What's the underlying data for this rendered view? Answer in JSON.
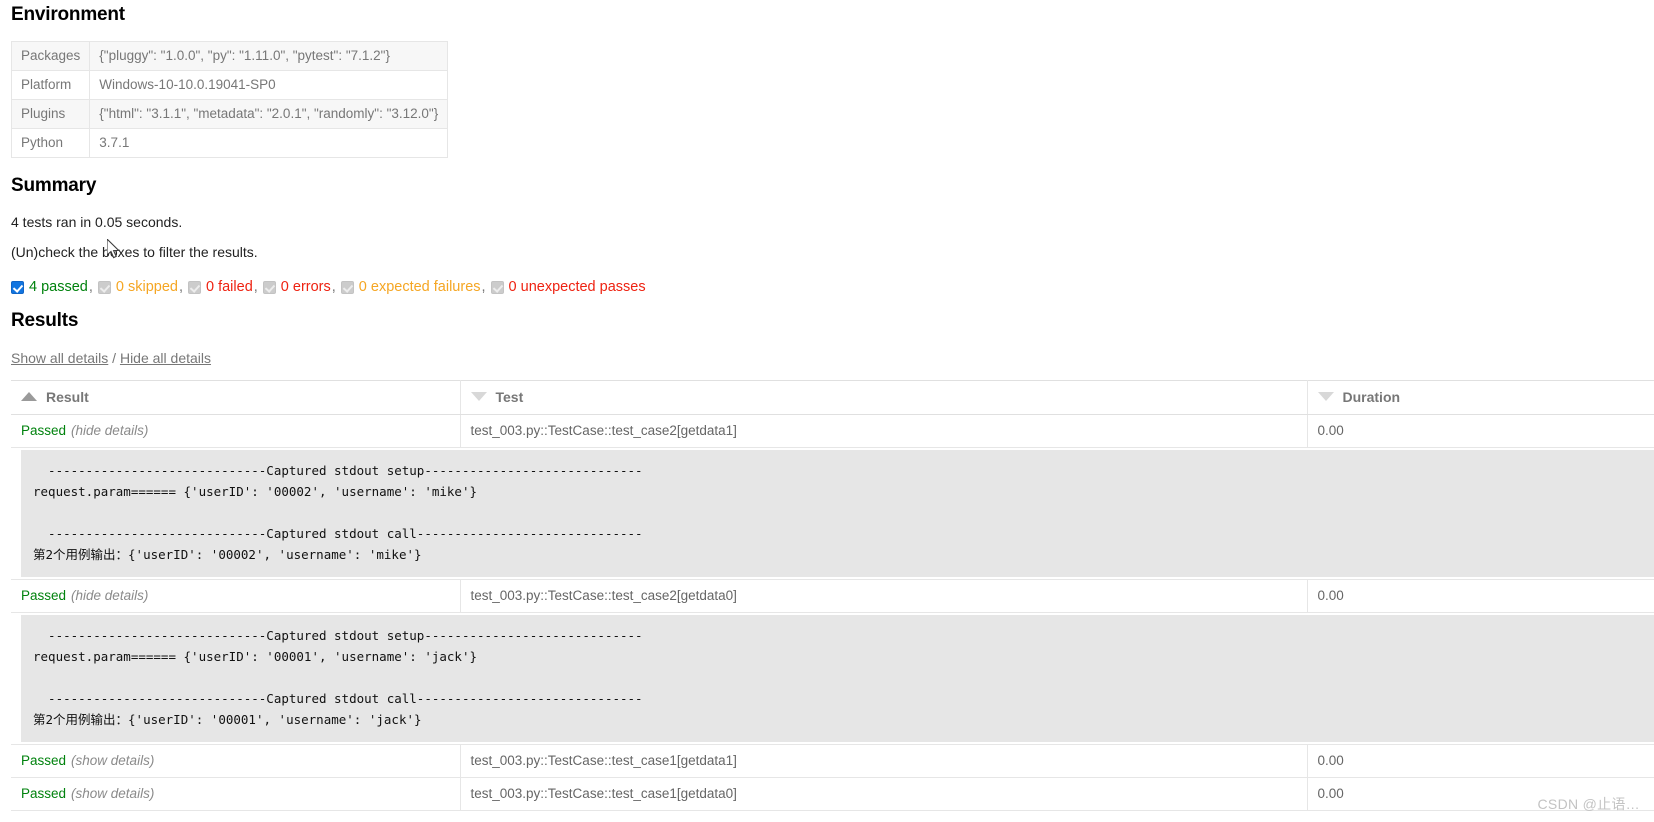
{
  "environment": {
    "title": "Environment",
    "rows": [
      {
        "key": "Packages",
        "value": "{\"pluggy\": \"1.0.0\", \"py\": \"1.11.0\", \"pytest\": \"7.1.2\"}"
      },
      {
        "key": "Platform",
        "value": "Windows-10-10.0.19041-SP0"
      },
      {
        "key": "Plugins",
        "value": "{\"html\": \"3.1.1\", \"metadata\": \"2.0.1\", \"randomly\": \"3.12.0\"}"
      },
      {
        "key": "Python",
        "value": "3.7.1"
      }
    ]
  },
  "summary": {
    "title": "Summary",
    "tests_ran": "4 tests ran in 0.05 seconds.",
    "filter_hint": "(Un)check the boxes to filter the results.",
    "filters": [
      {
        "label": "4 passed",
        "checked": true,
        "color": "#00820d",
        "trailing": ","
      },
      {
        "label": "0 skipped",
        "checked": false,
        "color": "#f5a623",
        "trailing": ","
      },
      {
        "label": "0 failed",
        "checked": false,
        "color": "#ee2211",
        "trailing": ","
      },
      {
        "label": "0 errors",
        "checked": false,
        "color": "#ee2211",
        "trailing": ","
      },
      {
        "label": "0 expected failures",
        "checked": false,
        "color": "#f5a623",
        "trailing": ","
      },
      {
        "label": "0 unexpected passes",
        "checked": false,
        "color": "#ee2211",
        "trailing": ""
      }
    ]
  },
  "results": {
    "title": "Results",
    "show_all_label": "Show all details",
    "separator": "/",
    "hide_all_label": "Hide all details",
    "columns": [
      {
        "label": "Result",
        "sort": "asc"
      },
      {
        "label": "Test",
        "sort": "desc"
      },
      {
        "label": "Duration",
        "sort": "desc"
      }
    ],
    "rows": [
      {
        "result": "Passed",
        "toggle": "(hide details)",
        "test": "test_003.py::TestCase::test_case2[getdata1]",
        "duration": "0.00",
        "log": "  -----------------------------Captured stdout setup-----------------------------\nrequest.param====== {'userID': '00002', 'username': 'mike'}\n\n  -----------------------------Captured stdout call------------------------------\n第2个用例输出：{'userID': '00002', 'username': 'mike'}"
      },
      {
        "result": "Passed",
        "toggle": "(hide details)",
        "test": "test_003.py::TestCase::test_case2[getdata0]",
        "duration": "0.00",
        "log": "  -----------------------------Captured stdout setup-----------------------------\nrequest.param====== {'userID': '00001', 'username': 'jack'}\n\n  -----------------------------Captured stdout call------------------------------\n第2个用例输出：{'userID': '00001', 'username': 'jack'}"
      },
      {
        "result": "Passed",
        "toggle": "(show details)",
        "test": "test_003.py::TestCase::test_case1[getdata1]",
        "duration": "0.00",
        "log": null
      },
      {
        "result": "Passed",
        "toggle": "(show details)",
        "test": "test_003.py::TestCase::test_case1[getdata0]",
        "duration": "0.00",
        "log": null
      }
    ]
  },
  "watermark": "CSDN @止语…"
}
